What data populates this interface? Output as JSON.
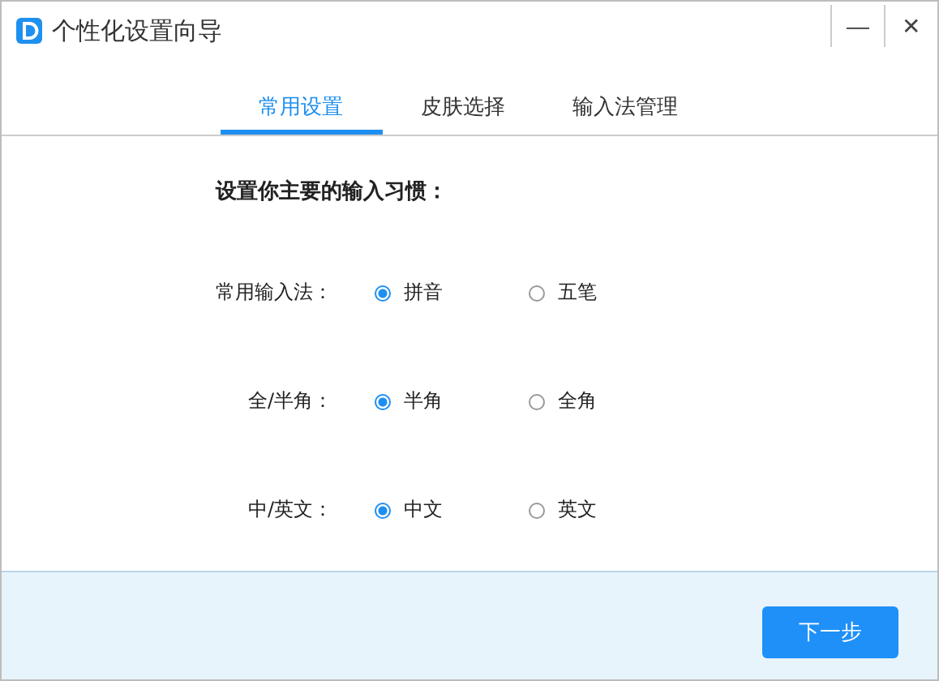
{
  "window": {
    "title": "个性化设置向导",
    "minimize": "—",
    "close": "✕"
  },
  "tabs": [
    {
      "label": "常用设置",
      "selected": true
    },
    {
      "label": "皮肤选择",
      "selected": false
    },
    {
      "label": "输入法管理",
      "selected": false
    }
  ],
  "heading": "设置你主要的输入习惯：",
  "settings": [
    {
      "label": "常用输入法：",
      "options": [
        {
          "label": "拼音",
          "selected": true
        },
        {
          "label": "五笔",
          "selected": false
        }
      ]
    },
    {
      "label": "全/半角：",
      "options": [
        {
          "label": "半角",
          "selected": true
        },
        {
          "label": "全角",
          "selected": false
        }
      ]
    },
    {
      "label": "中/英文：",
      "options": [
        {
          "label": "中文",
          "selected": true
        },
        {
          "label": "英文",
          "selected": false
        }
      ]
    }
  ],
  "buttons": [
    "下一步"
  ]
}
